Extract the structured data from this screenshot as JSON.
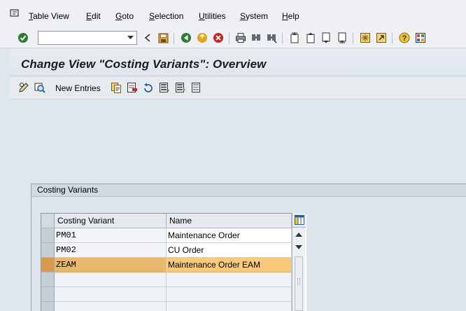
{
  "menubar": {
    "items": [
      {
        "label": "Table View",
        "mnemonic": "T",
        "rest": "able View"
      },
      {
        "label": "Edit",
        "mnemonic": "E",
        "rest": "dit"
      },
      {
        "label": "Goto",
        "mnemonic": "G",
        "rest": "oto"
      },
      {
        "label": "Selection",
        "mnemonic": "S",
        "rest": "election"
      },
      {
        "label": "Utilities",
        "mnemonic": "U",
        "rest": "tilities"
      },
      {
        "label": "System",
        "mnemonic": "S",
        "rest": "ystem"
      },
      {
        "label": "Help",
        "mnemonic": "H",
        "rest": "elp"
      }
    ]
  },
  "toolbar": {
    "command_value": "",
    "icons": [
      "enter-icon",
      "back-icon",
      "save-icon",
      "back-nav-icon",
      "exit-icon",
      "cancel-icon",
      "print-icon",
      "find-icon",
      "find-next-icon",
      "first-page-icon",
      "previous-page-icon",
      "next-page-icon",
      "last-page-icon",
      "create-session-icon",
      "shortcut-icon",
      "help-icon",
      "layout-icon"
    ]
  },
  "title": "Change View \"Costing Variants\": Overview",
  "app_toolbar": {
    "new_entries_label": "New Entries"
  },
  "group": {
    "title": "Costing Variants"
  },
  "table": {
    "columns": [
      "Costing Variant",
      "Name"
    ],
    "rows": [
      {
        "variant": "PM01",
        "name": "Maintenance Order",
        "selected": false
      },
      {
        "variant": "PM02",
        "name": "CU Order",
        "selected": false
      },
      {
        "variant": "ZEAM",
        "name": "Maintenance Order EAM",
        "selected": true
      },
      {
        "variant": "",
        "name": "",
        "selected": false
      },
      {
        "variant": "",
        "name": "",
        "selected": false
      },
      {
        "variant": "",
        "name": "",
        "selected": false
      }
    ]
  },
  "colors": {
    "selected_row": "#f7c97a",
    "background": "#dfe6ee"
  }
}
